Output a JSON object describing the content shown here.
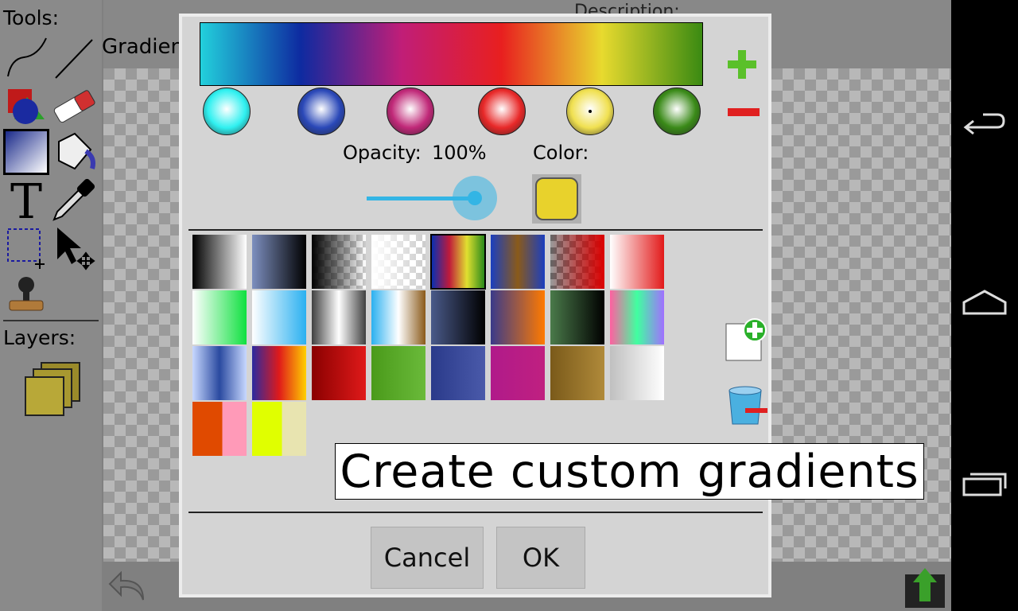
{
  "app": {
    "tools_label": "Tools:",
    "layers_label": "Layers:",
    "description_label": "Description:",
    "gradient_label": "Gradien"
  },
  "dialog": {
    "gradient_bar": {
      "stops": [
        "#22d0dc",
        "#0e2aa0",
        "#c01e78",
        "#e81f1f",
        "#e8da2e",
        "#3a8a12"
      ],
      "selected_stop_index": 4
    },
    "stop_buttons": [
      {
        "color": "#2ff0f0"
      },
      {
        "color": "#2a48b8"
      },
      {
        "color": "#c02878"
      },
      {
        "color": "#e82828"
      },
      {
        "color": "#f0e050"
      },
      {
        "color": "#3a8a18"
      }
    ],
    "opacity_label": "Opacity:",
    "opacity_value": "100%",
    "opacity_level": 1.0,
    "color_label": "Color:",
    "current_color": "#e8d22c",
    "presets": [
      [
        "#000000,#ffffff",
        "#7d8fbf,#000000",
        "checker-dark",
        "checker-light",
        "#0a2fb0,#c01a3a,#e0e030,#2a8a1a",
        "#1b3fbf,#8a5a1a,#1b3fbf",
        "checker-red",
        "#ffffff,#e21a1a"
      ],
      [
        "#ffffff,#10e040",
        "#ffffff,#2ab0f0",
        "#404040,#ffffff,#404040",
        "#2ab0f0,#ffffff,#8a5a1a",
        "#4a5a8a,#000000",
        "#3a3a8a,#ff7a00",
        "#4a7a4a,#000000",
        "#ff60a0,#40ffa0,#a070ff"
      ],
      [
        "#c8d8ff,#2a4aa0,#c8d8ff",
        "#2a2aa0,#e01a1a,#ffd000",
        "#8a0000,#e01a1a",
        "#4a9a1a,#6aba3a",
        "#2a3a8a,#4a5aaa",
        "#b01a8a,#c02080",
        "#7a5a1a,#b08a3a",
        "#c0c0c0,#ffffff"
      ],
      [
        "split:#e04a00,#ff9ab8",
        "split:#e0ff00,#e8e4b0"
      ]
    ],
    "tooltip_text": "Create custom gradients",
    "cancel_label": "Cancel",
    "ok_label": "OK"
  }
}
